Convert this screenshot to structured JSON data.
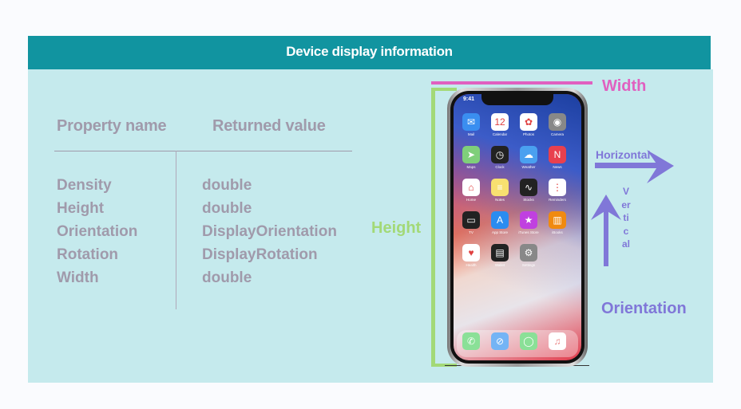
{
  "header": {
    "title": "Device display information"
  },
  "table": {
    "headers": [
      "Property name",
      "Returned value"
    ],
    "rows": [
      {
        "property": "Density",
        "value": "double"
      },
      {
        "property": "Height",
        "value": "double"
      },
      {
        "property": "Orientation",
        "value": "DisplayOrientation"
      },
      {
        "property": "Rotation",
        "value": "DisplayRotation"
      },
      {
        "property": "Width",
        "value": "double"
      }
    ]
  },
  "diagram": {
    "width_label": "Width",
    "height_label": "Height",
    "horizontal_label": "Horizontal",
    "vertical_label": "Vertical",
    "orientation_label": "Orientation",
    "colors": {
      "header": "#1194a0",
      "panel": "#c5eaed",
      "text": "#a09aab",
      "width": "#e060c0",
      "height": "#a3d977",
      "orientation": "#8077d8"
    }
  },
  "phone": {
    "time": "9:41",
    "apps": [
      {
        "label": "Mail",
        "icon": "✉",
        "color": "#3a8ef0"
      },
      {
        "label": "Calendar",
        "icon": "12",
        "color": "#ffffff"
      },
      {
        "label": "Photos",
        "icon": "✿",
        "color": "#ffffff"
      },
      {
        "label": "Camera",
        "icon": "◉",
        "color": "#888888"
      },
      {
        "label": "Maps",
        "icon": "➤",
        "color": "#7fcf7a"
      },
      {
        "label": "Clock",
        "icon": "◷",
        "color": "#222222"
      },
      {
        "label": "Weather",
        "icon": "☁",
        "color": "#4aa0f0"
      },
      {
        "label": "News",
        "icon": "N",
        "color": "#e8404e"
      },
      {
        "label": "Home",
        "icon": "⌂",
        "color": "#ffffff"
      },
      {
        "label": "Notes",
        "icon": "≡",
        "color": "#f8e070"
      },
      {
        "label": "Stocks",
        "icon": "∿",
        "color": "#222222"
      },
      {
        "label": "Reminders",
        "icon": "⋮",
        "color": "#ffffff"
      },
      {
        "label": "TV",
        "icon": "▭",
        "color": "#222222"
      },
      {
        "label": "App Store",
        "icon": "A",
        "color": "#2a8cf0"
      },
      {
        "label": "iTunes Store",
        "icon": "★",
        "color": "#c040e0"
      },
      {
        "label": "iBooks",
        "icon": "▥",
        "color": "#f08a10"
      },
      {
        "label": "Health",
        "icon": "♥",
        "color": "#ffffff"
      },
      {
        "label": "Wallet",
        "icon": "▤",
        "color": "#222222"
      },
      {
        "label": "Settings",
        "icon": "⚙",
        "color": "#888888"
      }
    ],
    "dock": [
      {
        "label": "Phone",
        "icon": "✆",
        "color": "#4cd060"
      },
      {
        "label": "Safari",
        "icon": "⊘",
        "color": "#2a8cf0"
      },
      {
        "label": "Messages",
        "icon": "◯",
        "color": "#4cd060"
      },
      {
        "label": "Music",
        "icon": "♫",
        "color": "#ffffff"
      }
    ]
  }
}
